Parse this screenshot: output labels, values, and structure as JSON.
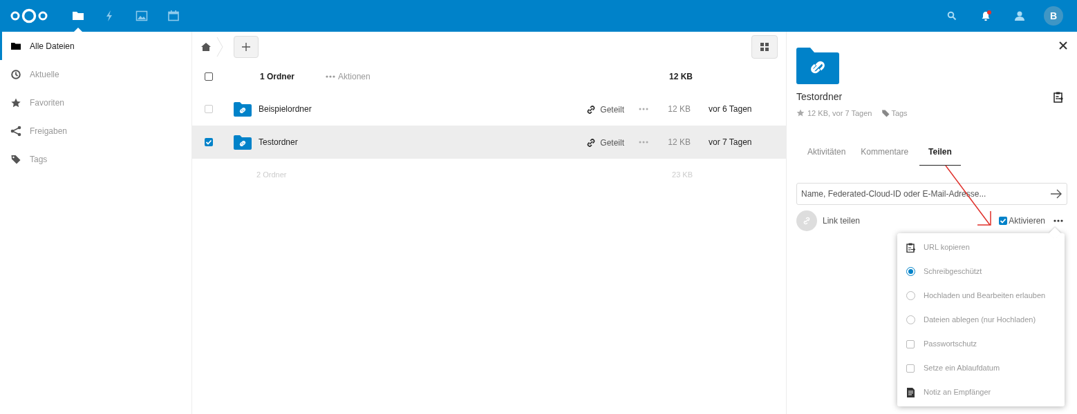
{
  "header": {
    "apps": [
      {
        "kind": "files",
        "selected": true
      },
      {
        "kind": "activity",
        "selected": false
      },
      {
        "kind": "gallery",
        "selected": false
      },
      {
        "kind": "calendar",
        "selected": false
      }
    ],
    "avatar_letter": "B",
    "notifications_unread": true
  },
  "sidebar": {
    "items": [
      {
        "kind": "folder",
        "label": "Alle Dateien",
        "selected": true
      },
      {
        "kind": "clock",
        "label": "Aktuelle",
        "selected": false
      },
      {
        "kind": "star",
        "label": "Favoriten",
        "selected": false
      },
      {
        "kind": "share",
        "label": "Freigaben",
        "selected": false
      },
      {
        "kind": "tag",
        "label": "Tags",
        "selected": false
      }
    ]
  },
  "file_list": {
    "header": {
      "checked": false,
      "count": "1 Ordner",
      "actions": "Aktionen",
      "size": "12 KB"
    },
    "rows": [
      {
        "name": "Beispielordner",
        "share_label": "Geteilt",
        "size": "12 KB",
        "modified": "vor 6 Tagen",
        "selected": false
      },
      {
        "name": "Testordner",
        "share_label": "Geteilt",
        "size": "12 KB",
        "modified": "vor 7 Tagen",
        "selected": true
      }
    ],
    "footer": {
      "count": "2 Ordner",
      "size": "23 KB"
    }
  },
  "details": {
    "title": "Testordner",
    "meta": "12 KB, vor 7 Tagen",
    "tags": "Tags",
    "tabs": [
      {
        "label": "Aktivitäten",
        "selected": false
      },
      {
        "label": "Kommentare",
        "selected": false
      },
      {
        "label": "Teilen",
        "selected": true
      }
    ],
    "share_input": {
      "placeholder": "Name, Federated-Cloud-ID oder E-Mail-Adresse..."
    },
    "link_share": {
      "label": "Link teilen",
      "enable_label": "Aktivieren",
      "enabled": true
    },
    "menu": [
      {
        "kind": "copy",
        "label": "URL kopieren"
      },
      {
        "kind": "radio",
        "label": "Schreibgeschützt",
        "selected": true
      },
      {
        "kind": "radio",
        "label": "Hochladen und Bearbeiten erlauben",
        "selected": false
      },
      {
        "kind": "radio",
        "label": "Dateien ablegen (nur Hochladen)",
        "selected": false
      },
      {
        "kind": "checkbox",
        "label": "Passwortschutz",
        "checked": false
      },
      {
        "kind": "checkbox",
        "label": "Setze ein Ablaufdatum",
        "checked": false
      },
      {
        "kind": "note",
        "label": "Notiz an Empfänger"
      }
    ]
  }
}
